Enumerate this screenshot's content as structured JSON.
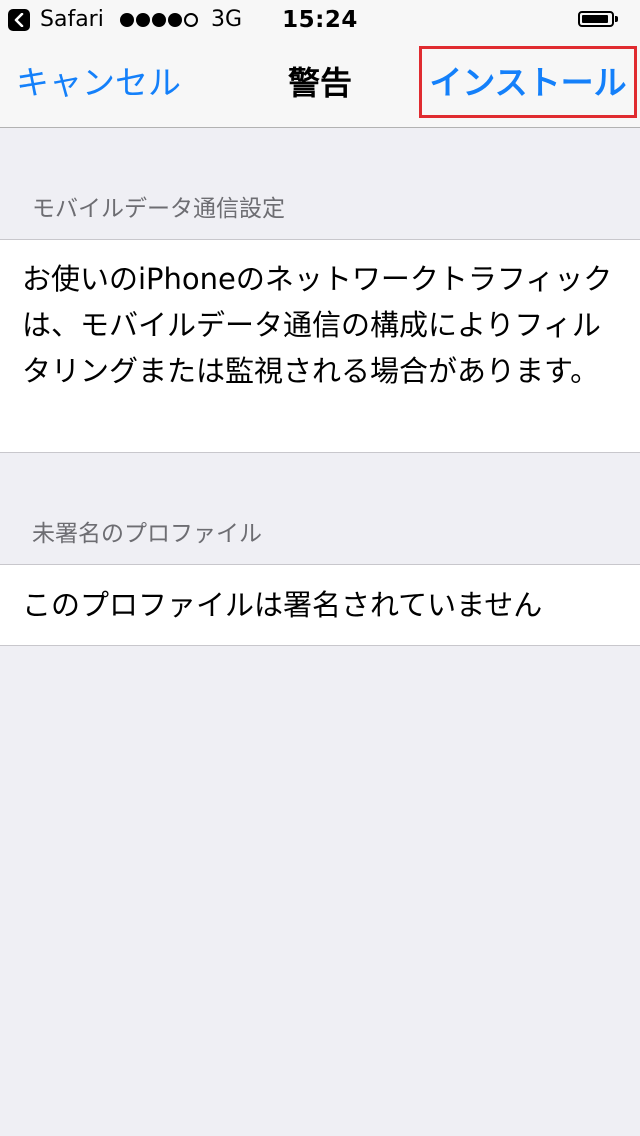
{
  "status_bar": {
    "back_app": "Safari",
    "signal_bars_filled": 4,
    "signal_bars_total": 5,
    "network": "3G",
    "time": "15:24",
    "battery_level": 0.8
  },
  "nav": {
    "cancel_label": "キャンセル",
    "title": "警告",
    "install_label": "インストール",
    "accent_color": "#1480fa",
    "highlight_color": "#e02b30"
  },
  "sections": [
    {
      "header": "モバイルデータ通信設定",
      "body": "お使いのiPhoneのネットワークトラフィックは、モバイルデータ通信の構成によりフィルタリングまたは監視される場合があります。"
    },
    {
      "header": "未署名のプロファイル",
      "body": "このプロファイルは署名されていません"
    }
  ]
}
